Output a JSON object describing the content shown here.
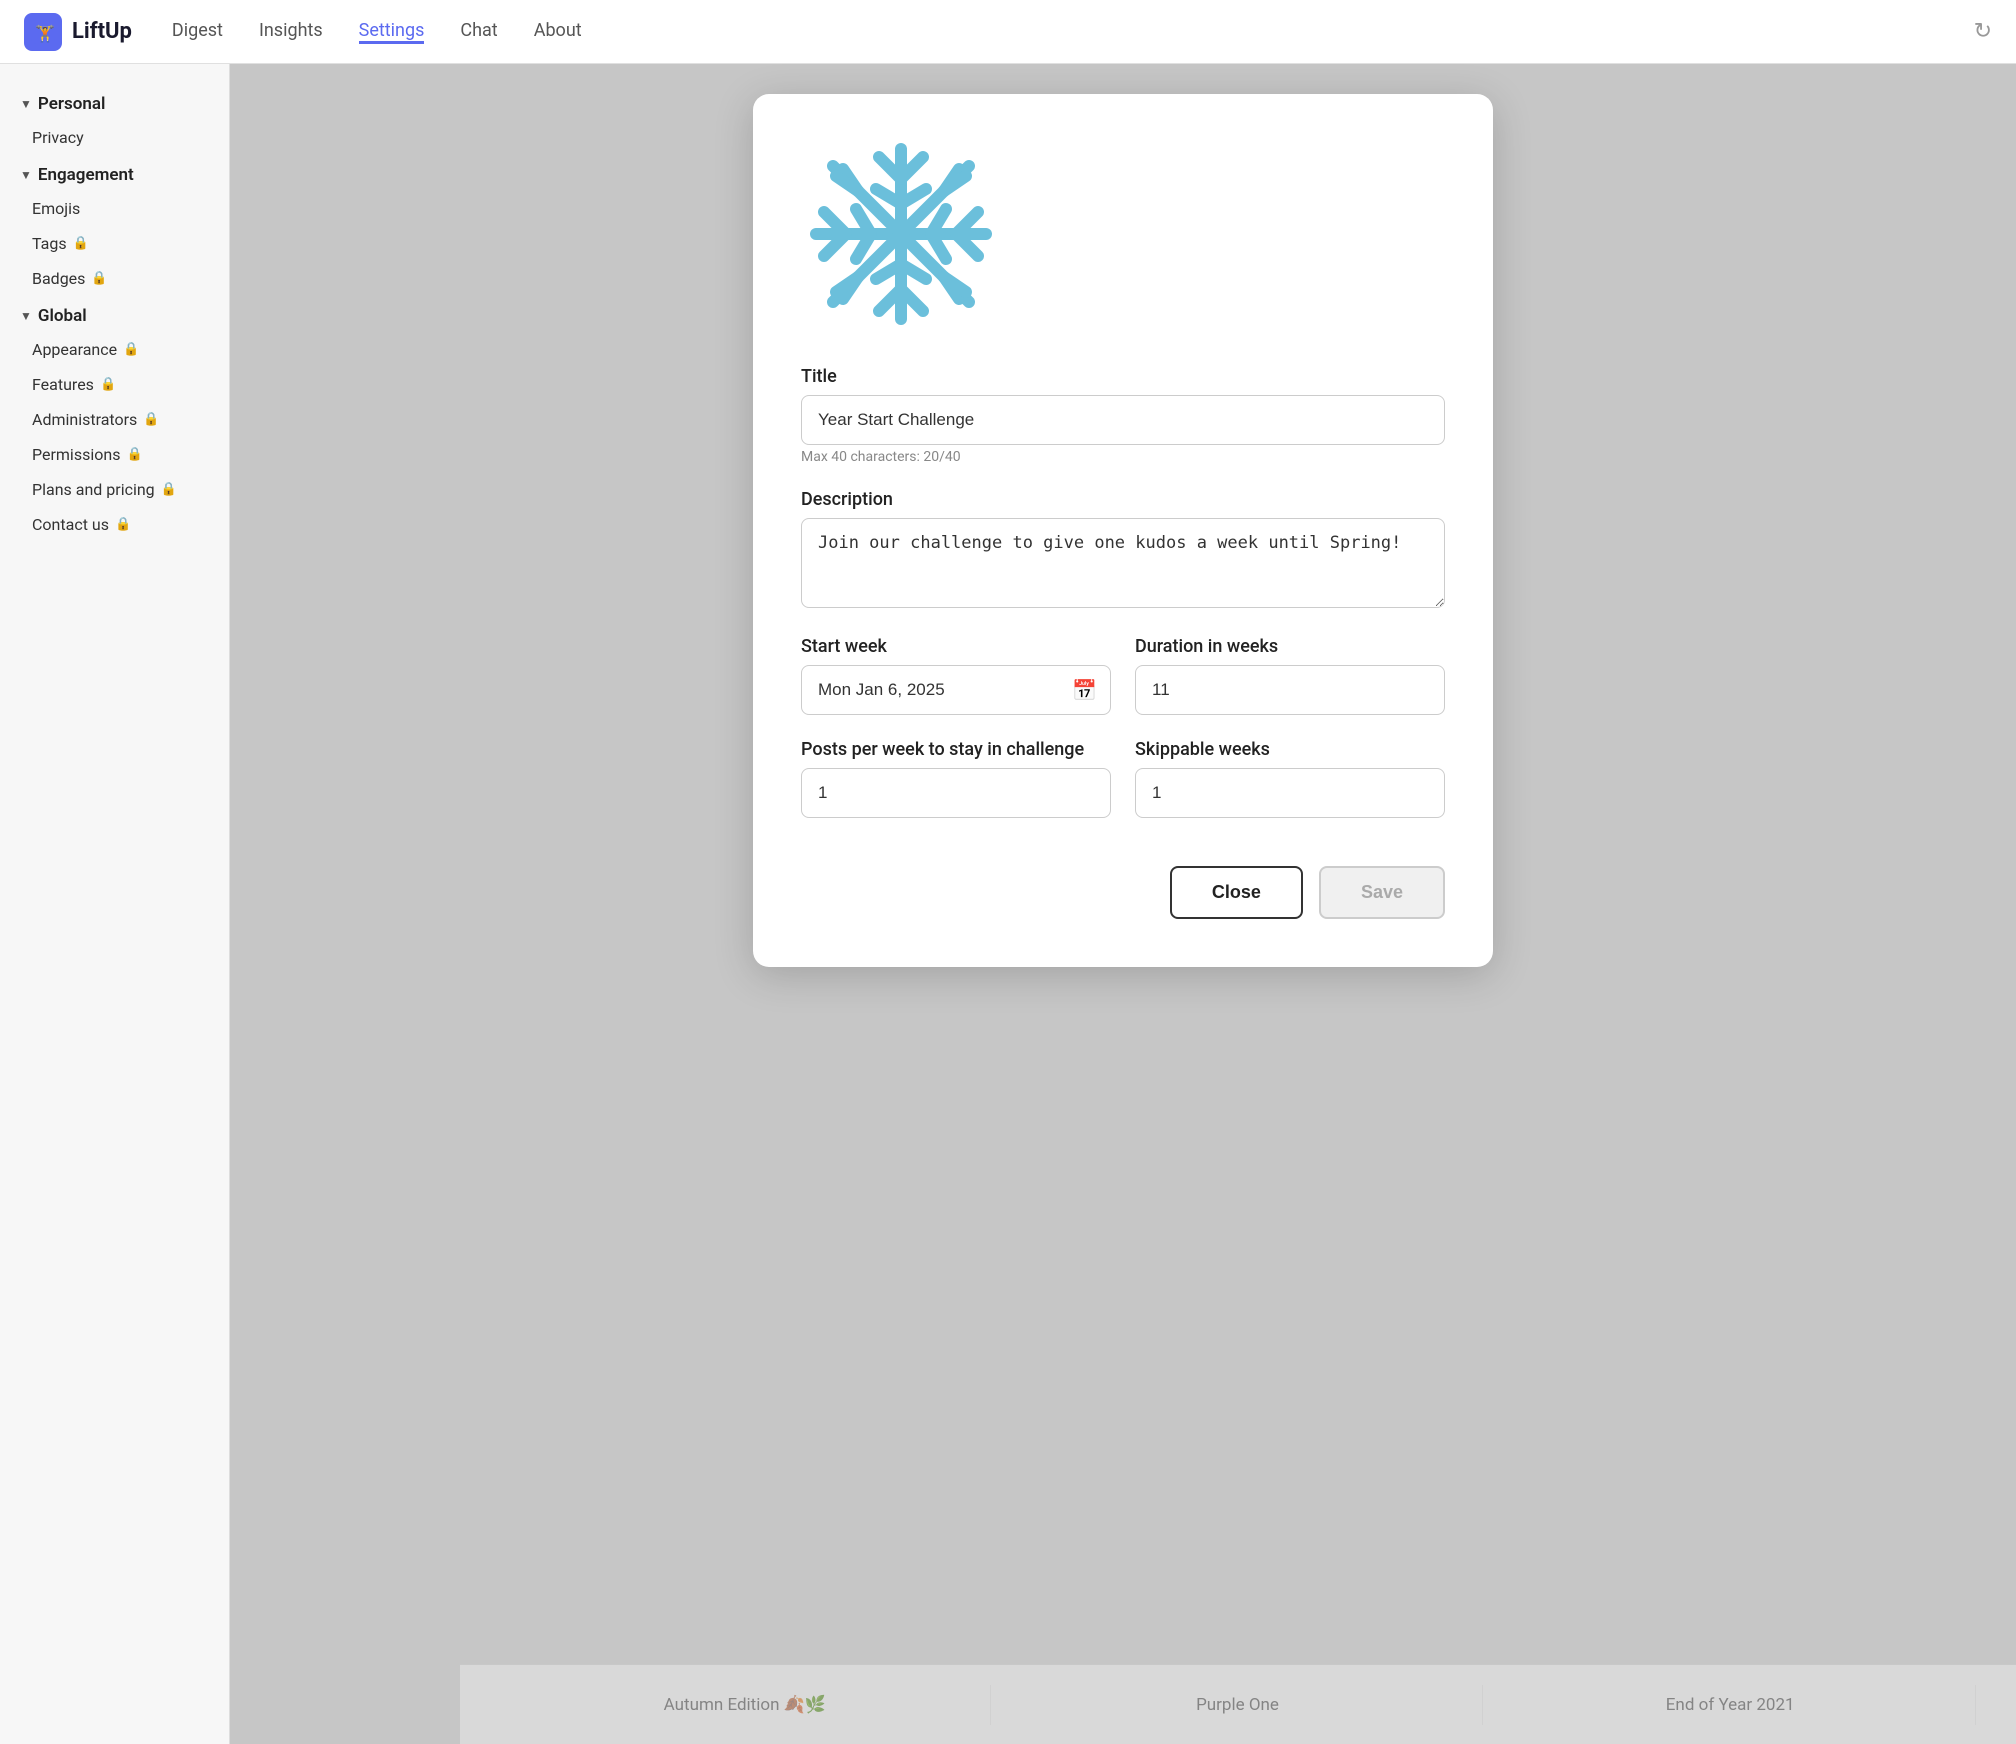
{
  "app": {
    "logo_text": "LiftUp",
    "logo_icon": "🏋"
  },
  "nav": {
    "items": [
      {
        "id": "digest",
        "label": "Digest",
        "active": false
      },
      {
        "id": "insights",
        "label": "Insights",
        "active": false
      },
      {
        "id": "settings",
        "label": "Settings",
        "active": true
      },
      {
        "id": "chat",
        "label": "Chat",
        "active": false
      },
      {
        "id": "about",
        "label": "About",
        "active": false
      }
    ]
  },
  "sidebar": {
    "sections": [
      {
        "id": "personal",
        "label": "Personal",
        "items": [
          {
            "id": "privacy",
            "label": "Privacy",
            "locked": false
          }
        ]
      },
      {
        "id": "engagement",
        "label": "Engagement",
        "items": [
          {
            "id": "emojis",
            "label": "Emojis",
            "locked": false
          },
          {
            "id": "tags",
            "label": "Tags",
            "locked": true
          },
          {
            "id": "badges",
            "label": "Badges",
            "locked": true
          }
        ]
      },
      {
        "id": "global",
        "label": "Global",
        "items": [
          {
            "id": "appearance",
            "label": "Appearance",
            "locked": true
          },
          {
            "id": "features",
            "label": "Features",
            "locked": true
          },
          {
            "id": "administrators",
            "label": "Administrators",
            "locked": true
          },
          {
            "id": "permissions",
            "label": "Permissions",
            "locked": true
          },
          {
            "id": "plans-and-pricing",
            "label": "Plans and pricing",
            "locked": true
          },
          {
            "id": "contact-us",
            "label": "Contact us",
            "locked": true
          }
        ]
      }
    ]
  },
  "modal": {
    "title_label": "Title",
    "title_value": "Year Start Challenge",
    "title_char_count": "Max 40 characters: 20/40",
    "description_label": "Description",
    "description_value": "Join our challenge to give one kudos a week until Spring!",
    "start_week_label": "Start week",
    "start_week_value": "Mon Jan 6, 2025",
    "duration_label": "Duration in weeks",
    "duration_value": "11",
    "posts_per_week_label": "Posts per week to stay in challenge",
    "posts_per_week_value": "1",
    "skippable_weeks_label": "Skippable weeks",
    "skippable_weeks_value": "1",
    "close_button": "Close",
    "save_button": "Save"
  },
  "bottom_tabs": [
    {
      "id": "autumn",
      "label": "Autumn Edition 🍂🌿"
    },
    {
      "id": "purple",
      "label": "Purple One"
    },
    {
      "id": "year-end",
      "label": "End of Year 2021"
    }
  ],
  "colors": {
    "accent": "#5b6af0",
    "snowflake": "#6bbfdb"
  }
}
